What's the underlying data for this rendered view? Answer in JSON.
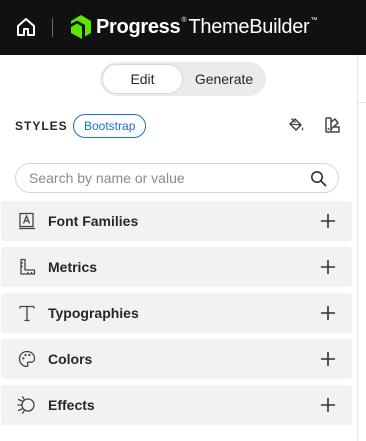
{
  "header": {
    "brand_name": "Progress",
    "brand_tm": "®",
    "product_name": "ThemeBuilder",
    "product_tm": "™",
    "logo_color": "#5ce500"
  },
  "mode_toggle": {
    "edit_label": "Edit",
    "generate_label": "Generate",
    "selected": "Edit"
  },
  "styles": {
    "label": "STYLES",
    "theme": "Bootstrap",
    "accent_color": "#1a6fd1"
  },
  "search": {
    "placeholder": "Search by name or value",
    "value": ""
  },
  "sections": [
    {
      "label": "Font Families",
      "icon": "font-families-icon"
    },
    {
      "label": "Metrics",
      "icon": "ruler-icon"
    },
    {
      "label": "Typographies",
      "icon": "text-icon"
    },
    {
      "label": "Colors",
      "icon": "palette-icon"
    },
    {
      "label": "Effects",
      "icon": "effects-icon"
    }
  ]
}
